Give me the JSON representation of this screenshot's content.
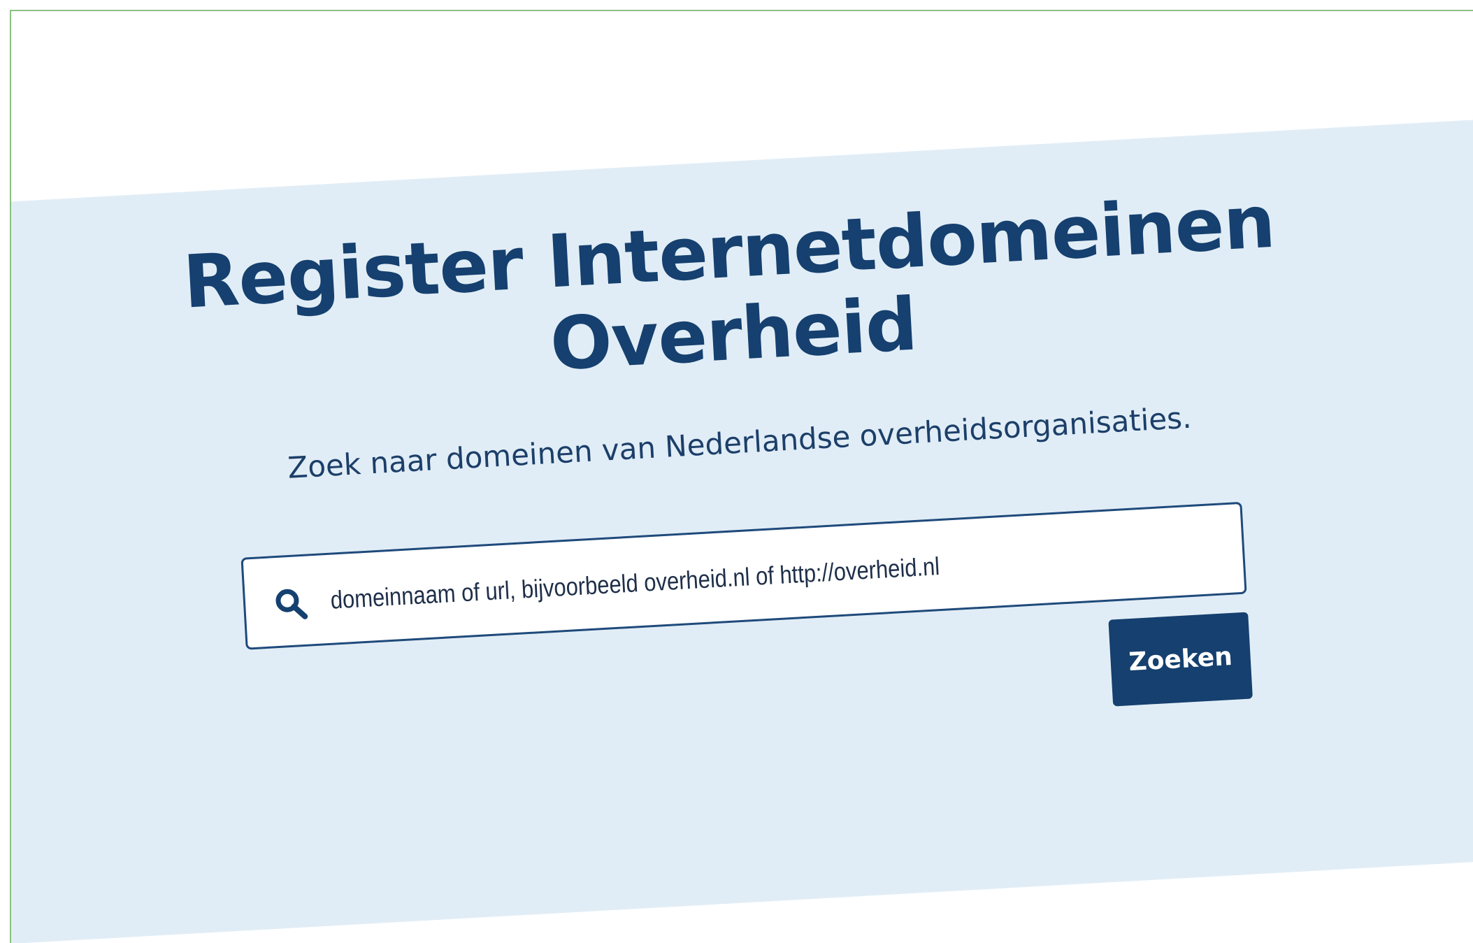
{
  "hero": {
    "title_line1": "Register Internetdomeinen",
    "title_line2": "Overheid",
    "subtitle": "Zoek naar domeinen van Nederlandse overheidsorganisaties."
  },
  "search": {
    "placeholder": "domeinnaam of url, bijvoorbeeld overheid.nl of http://overheid.nl",
    "value": "",
    "button_label": "Zoeken",
    "icon": "search-icon"
  },
  "colors": {
    "hero_background": "#e1edf6",
    "primary": "#15406f",
    "frame_border": "#8cc083"
  }
}
